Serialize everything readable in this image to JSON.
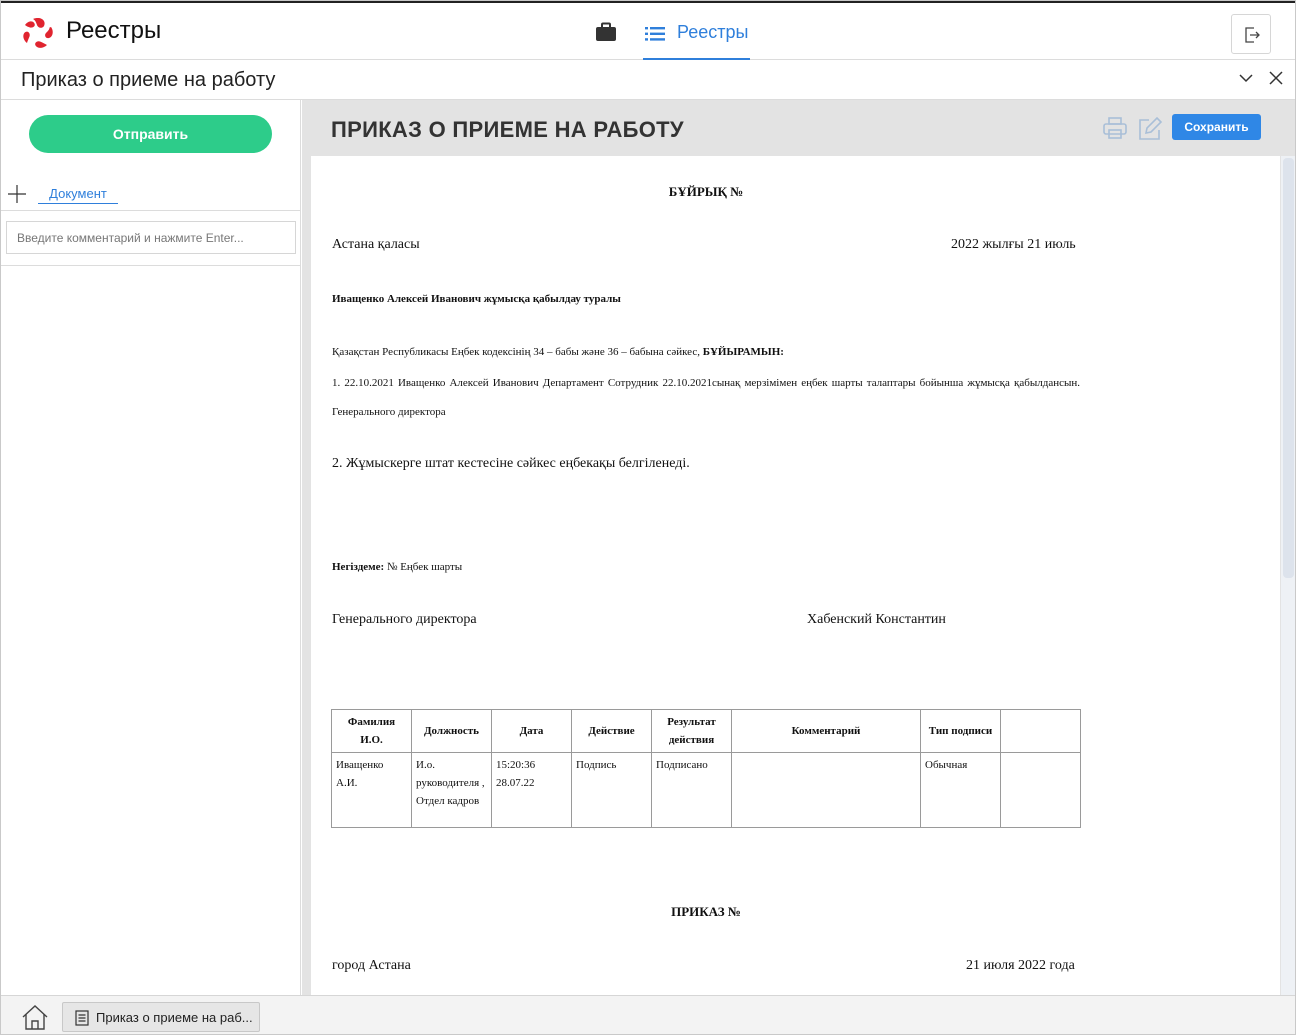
{
  "app": {
    "title": "Реестры",
    "nav_tab_label": "Реестры",
    "accent_color": "#2f7fdb",
    "logo_color": "#e0242f"
  },
  "docbar": {
    "title": "Приказ о приеме на работу"
  },
  "left": {
    "send_label": "Отправить",
    "doc_tab_label": "Документ",
    "comment_placeholder": "Введите комментарий и нажмите Enter..."
  },
  "right": {
    "title": "ПРИКАЗ О ПРИЕМЕ НА РАБОТУ",
    "save_label": "Сохранить"
  },
  "document": {
    "heading_kz": "БҰЙРЫҚ №",
    "city_kz": "Астана қаласы",
    "date_kz": "2022 жылғы 21 июль",
    "subject_kz": "Иващенко Алексей Иванович жұмысқа қабылдау туралы",
    "basis_text": "Қазақстан Республикасы Еңбек кодексінің 34 – бабы және 36 – бабына сәйкес,",
    "basis_bold": "БҰЙЫРАМЫН:",
    "item1": "1. 22.10.2021 Иващенко Алексей Иванович Департамент Сотрудник 22.10.2021сынақ мерзімімен еңбек шарты талаптары бойынша жұмысқа қабылдансын. Генерального директора",
    "item2": "2. Жұмыскерге штат кестесіне сәйкес еңбекақы белгіленеді.",
    "grounds_label": "Негіздеме:",
    "grounds_value": "№ Еңбек шарты",
    "signer_position": "Генерального директора",
    "signer_name": "Хабенский Константин",
    "heading_ru": "ПРИКАЗ №",
    "city_ru": "город Астана",
    "date_ru": "21 июля 2022 года"
  },
  "signatures": {
    "headers": [
      "Фамилия И.О.",
      "Должность",
      "Дата",
      "Действие",
      "Результат действия",
      "Комментарий",
      "Тип подписи",
      ""
    ],
    "rows": [
      [
        "Иващенко А.И.",
        "И.о. руководителя , Отдел кадров",
        "15:20:36 28.07.22",
        "Подпись",
        "Подписано",
        "",
        "Обычная",
        ""
      ]
    ]
  },
  "taskbar": {
    "item_label": "Приказ о приеме на раб..."
  }
}
